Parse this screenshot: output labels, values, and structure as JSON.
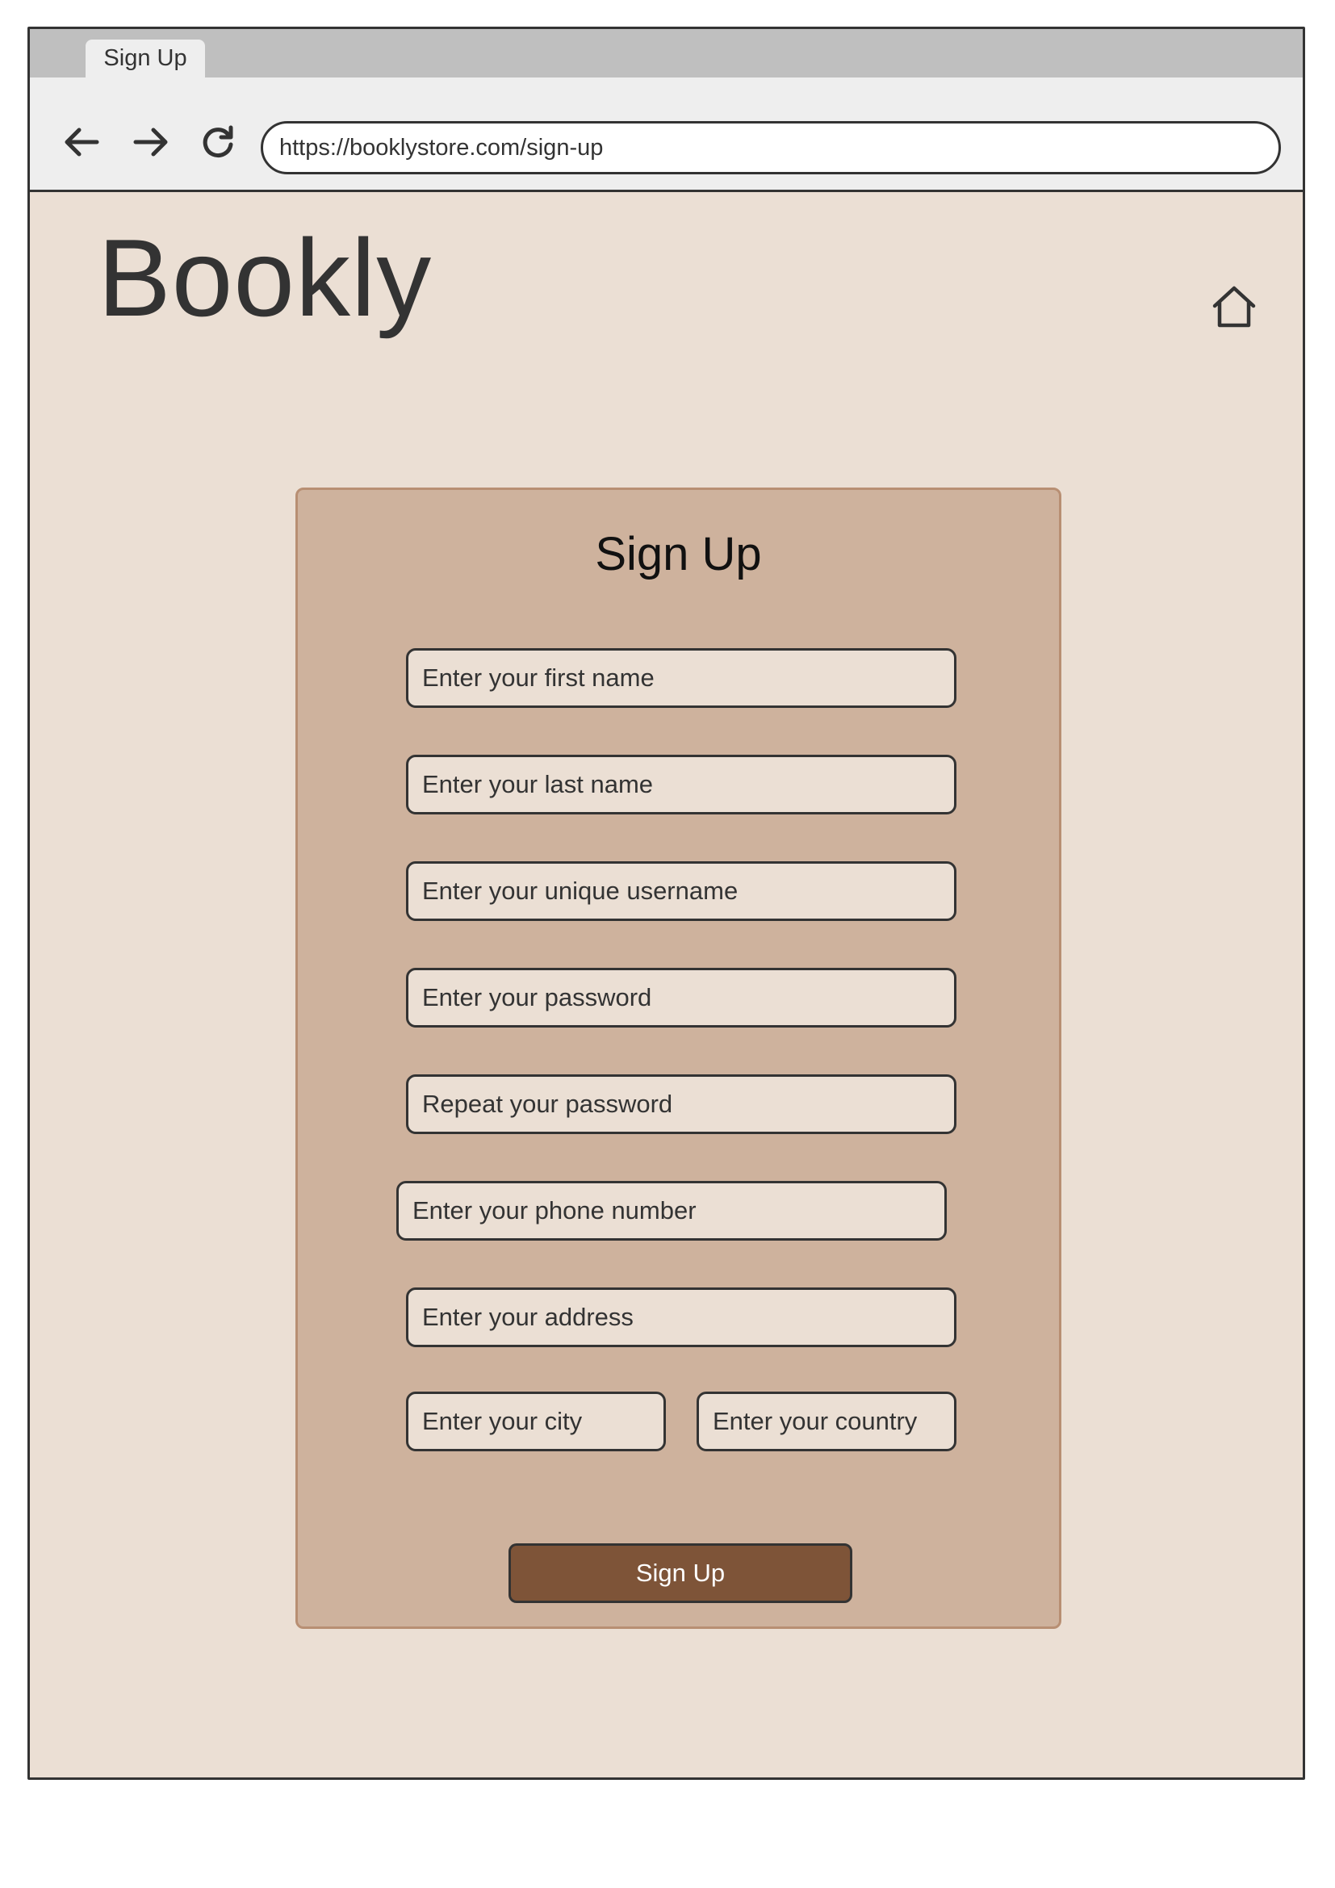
{
  "browser": {
    "tab_title": "Sign Up",
    "url": "https://booklystore.com/sign-up",
    "icons": [
      "back-arrow-icon",
      "forward-arrow-icon",
      "reload-icon"
    ]
  },
  "header": {
    "brand": "Bookly",
    "home_icon": "home-icon"
  },
  "form": {
    "title": "Sign Up",
    "fields": {
      "first_name": "Enter your first name",
      "last_name": "Enter your last name",
      "username": "Enter your unique username",
      "password": "Enter your password",
      "repeat_password": "Repeat your password",
      "phone": "Enter your phone number",
      "address": "Enter your address",
      "city": "Enter your city",
      "country": "Enter your country"
    },
    "submit_label": "Sign Up"
  },
  "colors": {
    "page_background": "#ebdfd4",
    "card_background": "#ceb29d",
    "button_background": "#7e5438"
  }
}
